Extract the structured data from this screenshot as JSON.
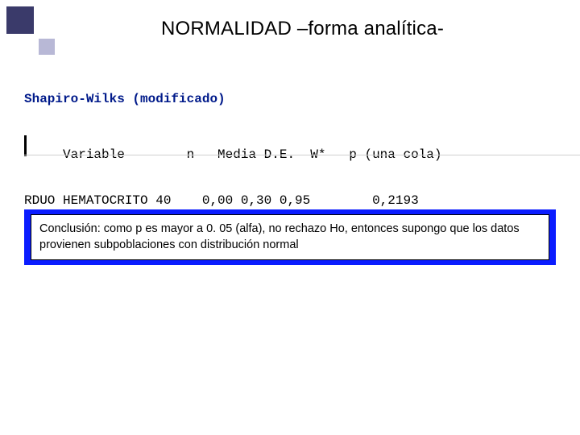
{
  "title": "NORMALIDAD –forma analítica-",
  "test": {
    "heading": "Shapiro-Wilks (modificado)",
    "header_line": "     Variable        n   Media D.E.  W*   p (una cola)",
    "data_line": "RDUO HEMATOCRITO 40    0,00 0,30 0,95        0,2193"
  },
  "conclusion": "Conclusión: como p es mayor a 0. 05 (alfa), no rechazo Ho, entonces supongo que los datos provienen subpoblaciones con distribución normal"
}
